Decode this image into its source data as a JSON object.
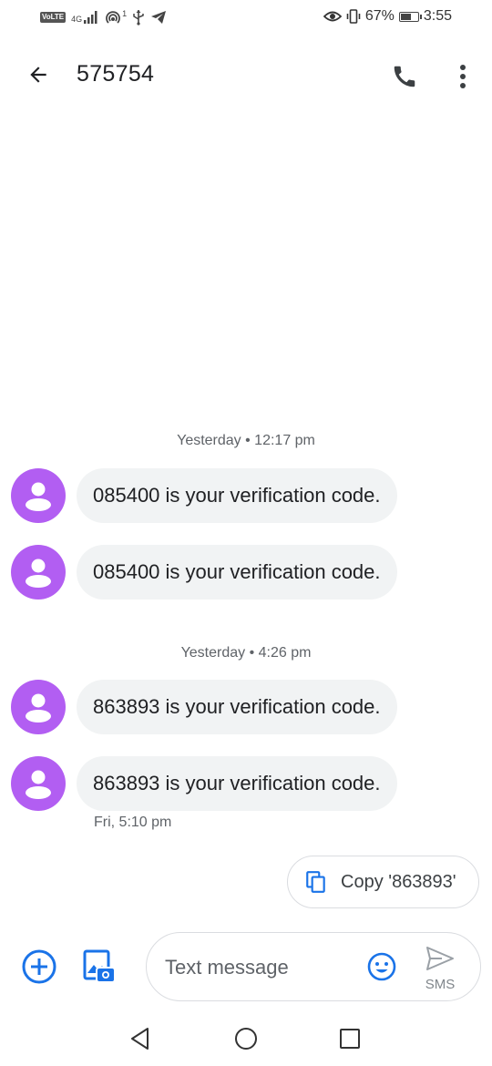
{
  "status_bar": {
    "volte": "VoLTE",
    "network": "4G",
    "hotspot_count": "1",
    "battery": "67%",
    "battery_level": 0.67,
    "time": "3:55"
  },
  "header": {
    "title": "575754",
    "icons": [
      "arrow-back-icon",
      "phone-icon",
      "more-vert-icon"
    ]
  },
  "conversation": {
    "groups": [
      {
        "timestamp": "Yesterday • 12:17 pm",
        "messages": [
          "085400 is your verification code.",
          "085400 is your verification code."
        ]
      },
      {
        "timestamp": "Yesterday • 4:26 pm",
        "messages": [
          "863893 is your verification code.",
          "863893 is your verification code."
        ]
      }
    ],
    "last_message_time": "Fri, 5:10 pm"
  },
  "suggestion": {
    "label": "Copy '863893'"
  },
  "compose": {
    "placeholder": "Text message",
    "value": "",
    "send_label": "SMS"
  },
  "colors": {
    "avatar": "#b25ef2",
    "accent": "#1a73e8",
    "bubble": "#f1f3f4"
  }
}
